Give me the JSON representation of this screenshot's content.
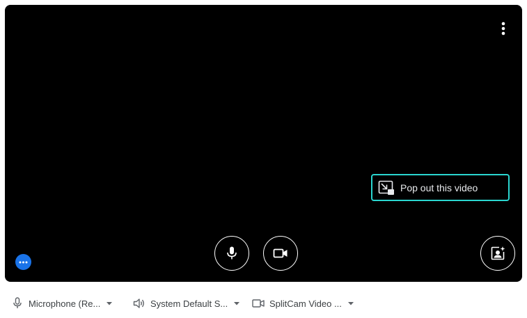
{
  "preview": {
    "pop_out_label": "Pop out this video",
    "more_options_icon": "more-vert-icon",
    "mic_icon": "microphone-icon",
    "camera_icon": "videocam-icon",
    "effects_icon": "visual-effects-icon",
    "status_icon": "more-horiz-icon"
  },
  "devices": {
    "microphone_label": "Microphone (Re...",
    "speaker_label": "System Default S...",
    "camera_label": "SplitCam Video ..."
  },
  "colors": {
    "preview_bg": "#000000",
    "accent_outline": "#2ad6d0",
    "status_blue": "#1a73e8",
    "device_text": "#3c4043"
  }
}
